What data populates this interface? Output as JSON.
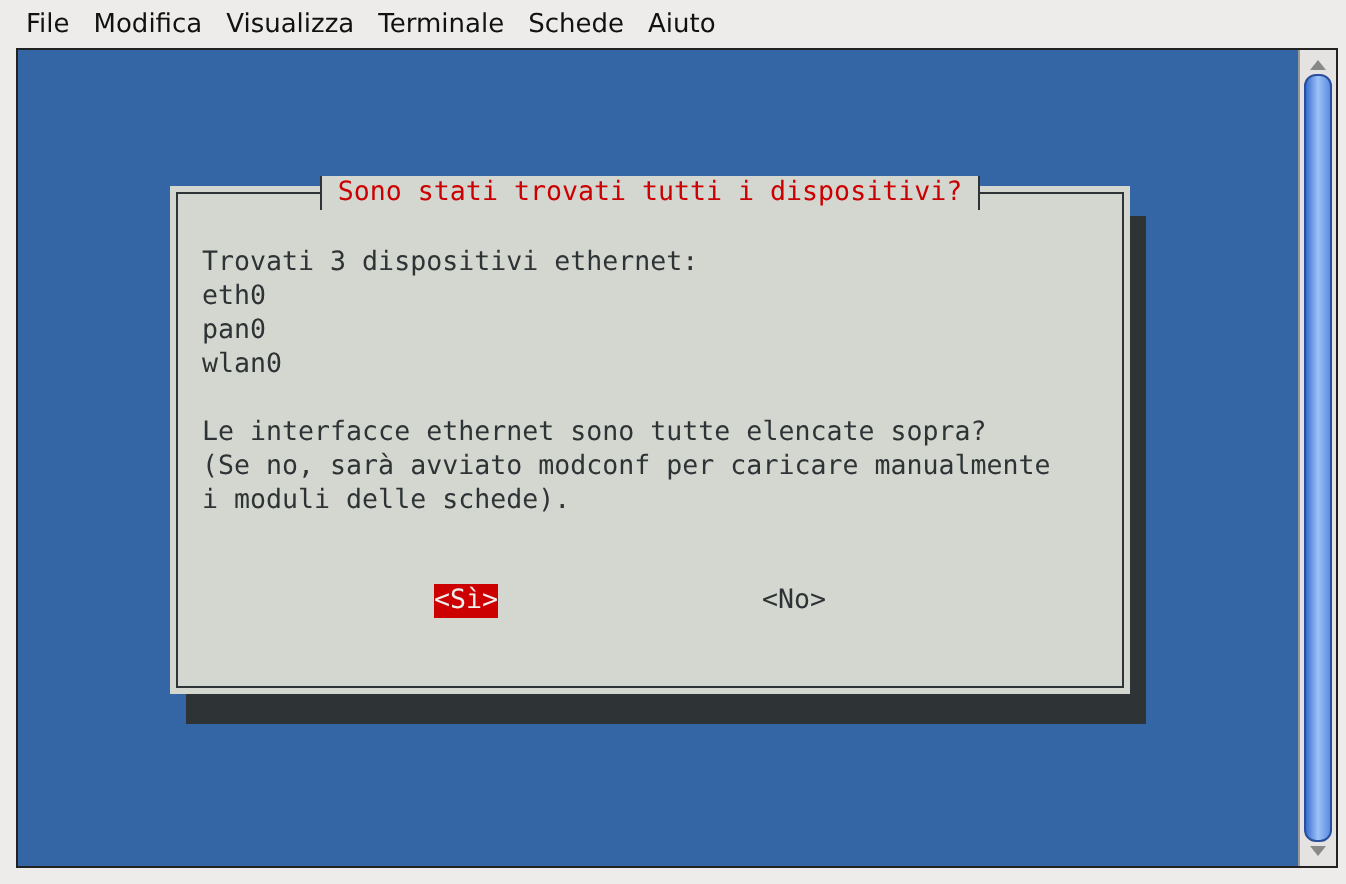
{
  "menu": [
    {
      "label": "File"
    },
    {
      "label": "Modifica"
    },
    {
      "label": "Visualizza"
    },
    {
      "label": "Terminale"
    },
    {
      "label": "Schede"
    },
    {
      "label": "Aiuto"
    }
  ],
  "dialog": {
    "title": "Sono stati trovati tutti i dispositivi?",
    "paragraphs": [
      [
        "Trovati 3 dispositivi ethernet:",
        "eth0",
        "pan0",
        "wlan0"
      ],
      [
        "Le interfacce ethernet sono tutte elencate sopra?",
        "(Se no, sarà avviato modconf per caricare manualmente",
        "i moduli delle schede)."
      ]
    ],
    "buttons": [
      {
        "label": "<Sì>",
        "selected": true
      },
      {
        "label": "<No>",
        "selected": false
      }
    ]
  }
}
